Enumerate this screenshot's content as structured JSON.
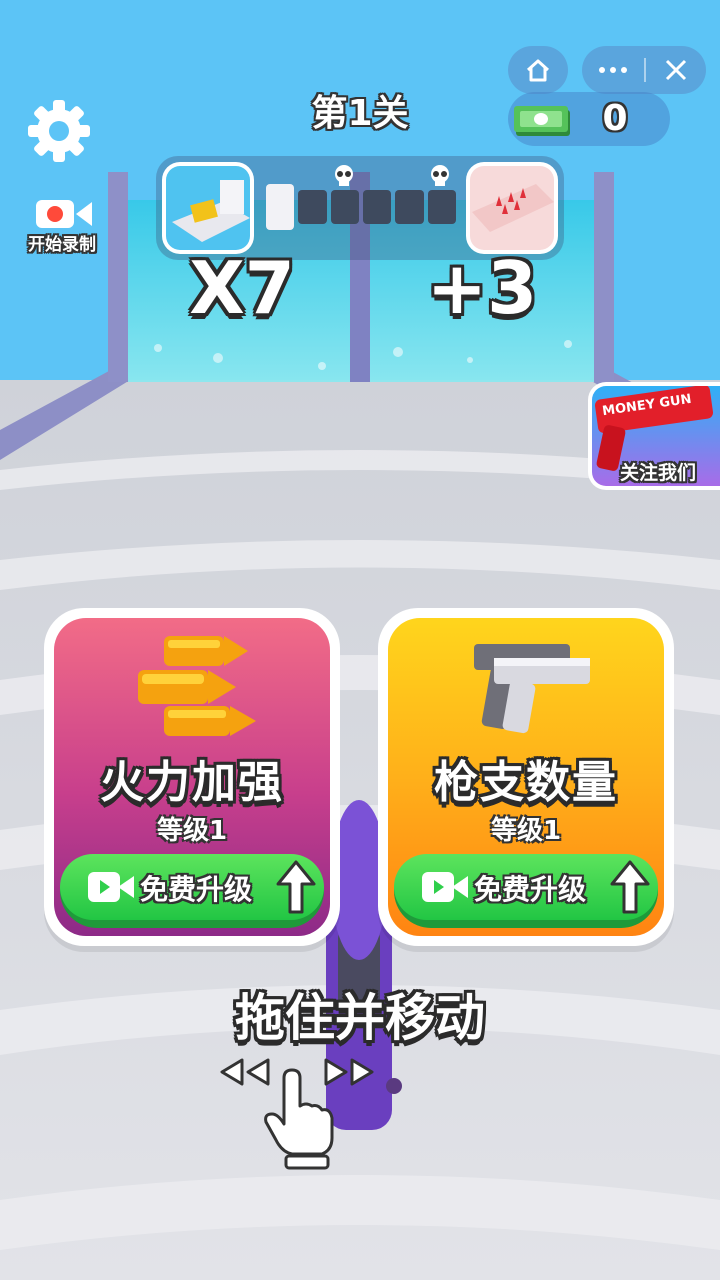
{
  "level_title": "第1关",
  "record_label": "开始录制",
  "money": {
    "value": "0"
  },
  "gates": {
    "left_text": "X7",
    "right_text": "+3"
  },
  "progress": {
    "filled_segments": 1,
    "total_segments": 6
  },
  "promo": {
    "brand": "MONEY GUN",
    "label": "关注我们"
  },
  "cards": [
    {
      "title": "火力加强",
      "level": "等级1",
      "button": "免费升级"
    },
    {
      "title": "枪支数量",
      "level": "等级1",
      "button": "免费升级"
    }
  ],
  "hint": "拖住并移动",
  "colors": {
    "sky": "#5cc4f6",
    "card_left_top": "#f06a86",
    "card_left_bottom": "#9a2c8a",
    "card_right_top": "#ffd21a",
    "card_right_bottom": "#ff8a12",
    "button_green": "#2fcf4b"
  }
}
